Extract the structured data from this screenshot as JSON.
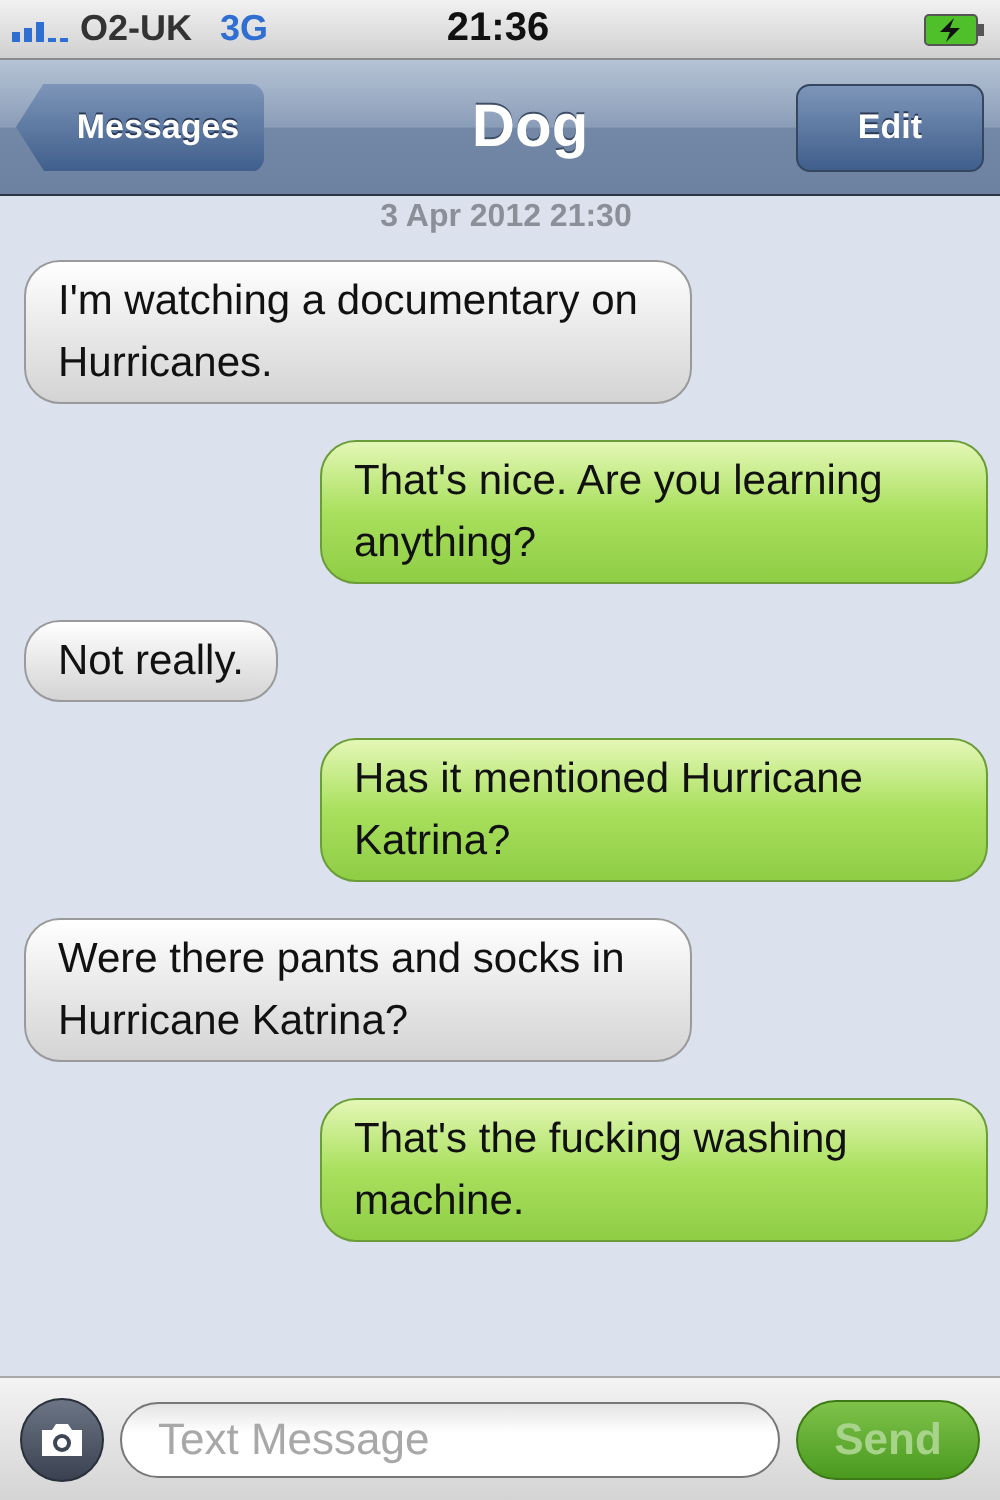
{
  "status_bar": {
    "carrier": "O2-UK",
    "network": "3G",
    "time": "21:36"
  },
  "nav_bar": {
    "back_button": "Messages",
    "title": "Dog",
    "edit_button": "Edit"
  },
  "timestamp": "3 Apr 2012 21:30",
  "messages": [
    {
      "kind": "received",
      "text": "I'm watching a documentary on Hurricanes."
    },
    {
      "kind": "sent",
      "text": "That's nice. Are you learning anything?"
    },
    {
      "kind": "received",
      "text": "Not really."
    },
    {
      "kind": "sent",
      "text": "Has it mentioned Hurricane  Katrina?"
    },
    {
      "kind": "received",
      "text": "Were there pants and socks in Hurricane Katrina?"
    },
    {
      "kind": "sent",
      "text": "That's the fucking washing machine."
    }
  ],
  "composer": {
    "placeholder": "Text Message",
    "send_button": {
      "label": "Send",
      "disabled": true
    }
  }
}
